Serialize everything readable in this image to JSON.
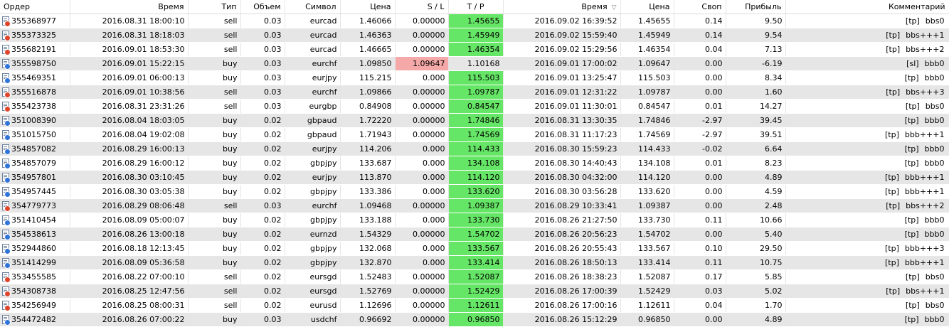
{
  "headers": {
    "order": "Ордер",
    "open_time": "Время",
    "type": "Тип",
    "volume": "Объем",
    "symbol": "Символ",
    "open_price": "Цена",
    "sl": "S / L",
    "tp": "T / P",
    "close_time": "Время",
    "close_price": "Цена",
    "swap": "Своп",
    "profit": "Прибыль",
    "comment": "Комментарий"
  },
  "sort_indicator": "▽",
  "colors": {
    "tp_highlight": "#66e666",
    "sl_highlight": "#f5a8a8",
    "alt_row": "#e6e6e6"
  },
  "rows": [
    {
      "order": "355368977",
      "open_time": "2016.08.31 18:00:10",
      "type": "sell",
      "volume": "0.03",
      "symbol": "eurcad",
      "open_price": "1.46066",
      "sl": "0.00000",
      "tp": "1.45655",
      "close_time": "2016.09.02 16:39:52",
      "close_price": "1.45655",
      "swap": "0.14",
      "profit": "9.50",
      "comment_tag": "[tp]",
      "comment_text": "bbs0",
      "hl": "tp"
    },
    {
      "order": "355373325",
      "open_time": "2016.08.31 18:18:03",
      "type": "sell",
      "volume": "0.03",
      "symbol": "eurcad",
      "open_price": "1.46363",
      "sl": "0.00000",
      "tp": "1.45949",
      "close_time": "2016.09.02 15:59:40",
      "close_price": "1.45949",
      "swap": "0.14",
      "profit": "9.54",
      "comment_tag": "[tp]",
      "comment_text": "bbs+++1",
      "hl": "tp"
    },
    {
      "order": "355682191",
      "open_time": "2016.09.01 18:53:30",
      "type": "sell",
      "volume": "0.03",
      "symbol": "eurcad",
      "open_price": "1.46665",
      "sl": "0.00000",
      "tp": "1.46354",
      "close_time": "2016.09.02 15:29:56",
      "close_price": "1.46354",
      "swap": "0.04",
      "profit": "7.13",
      "comment_tag": "[tp]",
      "comment_text": "bbs+++2",
      "hl": "tp"
    },
    {
      "order": "355598750",
      "open_time": "2016.09.01 15:22:15",
      "type": "buy",
      "volume": "0.03",
      "symbol": "eurchf",
      "open_price": "1.09850",
      "sl": "1.09647",
      "tp": "1.10168",
      "close_time": "2016.09.01 17:00:02",
      "close_price": "1.09647",
      "swap": "0.00",
      "profit": "-6.19",
      "comment_tag": "[sl]",
      "comment_text": "bbb0",
      "hl": "sl"
    },
    {
      "order": "355469351",
      "open_time": "2016.09.01 06:00:13",
      "type": "buy",
      "volume": "0.03",
      "symbol": "eurjpy",
      "open_price": "115.215",
      "sl": "0.000",
      "tp": "115.503",
      "close_time": "2016.09.01 13:25:47",
      "close_price": "115.503",
      "swap": "0.00",
      "profit": "8.34",
      "comment_tag": "[tp]",
      "comment_text": "bbb0",
      "hl": "tp"
    },
    {
      "order": "355516878",
      "open_time": "2016.09.01 10:38:56",
      "type": "sell",
      "volume": "0.03",
      "symbol": "eurchf",
      "open_price": "1.09866",
      "sl": "0.00000",
      "tp": "1.09787",
      "close_time": "2016.09.01 12:31:22",
      "close_price": "1.09787",
      "swap": "0.00",
      "profit": "1.60",
      "comment_tag": "[tp]",
      "comment_text": "bbs+++3",
      "hl": "tp"
    },
    {
      "order": "355423738",
      "open_time": "2016.08.31 23:31:26",
      "type": "sell",
      "volume": "0.03",
      "symbol": "eurgbp",
      "open_price": "0.84908",
      "sl": "0.00000",
      "tp": "0.84547",
      "close_time": "2016.09.01 11:30:01",
      "close_price": "0.84547",
      "swap": "0.01",
      "profit": "14.27",
      "comment_tag": "[tp]",
      "comment_text": "bbs0",
      "hl": "tp"
    },
    {
      "order": "351008390",
      "open_time": "2016.08.04 18:03:05",
      "type": "buy",
      "volume": "0.02",
      "symbol": "gbpaud",
      "open_price": "1.72220",
      "sl": "0.00000",
      "tp": "1.74846",
      "close_time": "2016.08.31 13:30:35",
      "close_price": "1.74846",
      "swap": "-2.97",
      "profit": "39.45",
      "comment_tag": "[tp]",
      "comment_text": "bbb0",
      "hl": "tp"
    },
    {
      "order": "351015750",
      "open_time": "2016.08.04 19:02:08",
      "type": "buy",
      "volume": "0.02",
      "symbol": "gbpaud",
      "open_price": "1.71943",
      "sl": "0.00000",
      "tp": "1.74569",
      "close_time": "2016.08.31 11:17:23",
      "close_price": "1.74569",
      "swap": "-2.97",
      "profit": "39.51",
      "comment_tag": "[tp]",
      "comment_text": "bbb+++1",
      "hl": "tp"
    },
    {
      "order": "354857082",
      "open_time": "2016.08.29 16:00:13",
      "type": "buy",
      "volume": "0.02",
      "symbol": "eurjpy",
      "open_price": "114.206",
      "sl": "0.000",
      "tp": "114.433",
      "close_time": "2016.08.30 15:59:23",
      "close_price": "114.433",
      "swap": "-0.02",
      "profit": "6.64",
      "comment_tag": "[tp]",
      "comment_text": "bbb0",
      "hl": "tp"
    },
    {
      "order": "354857079",
      "open_time": "2016.08.29 16:00:12",
      "type": "buy",
      "volume": "0.02",
      "symbol": "gbpjpy",
      "open_price": "133.687",
      "sl": "0.000",
      "tp": "134.108",
      "close_time": "2016.08.30 14:40:43",
      "close_price": "134.108",
      "swap": "0.01",
      "profit": "8.23",
      "comment_tag": "[tp]",
      "comment_text": "bbb0",
      "hl": "tp"
    },
    {
      "order": "354957801",
      "open_time": "2016.08.30 03:10:45",
      "type": "buy",
      "volume": "0.02",
      "symbol": "eurjpy",
      "open_price": "113.870",
      "sl": "0.000",
      "tp": "114.120",
      "close_time": "2016.08.30 04:32:00",
      "close_price": "114.120",
      "swap": "0.00",
      "profit": "4.89",
      "comment_tag": "[tp]",
      "comment_text": "bbb+++1",
      "hl": "tp"
    },
    {
      "order": "354957445",
      "open_time": "2016.08.30 03:05:38",
      "type": "buy",
      "volume": "0.02",
      "symbol": "gbpjpy",
      "open_price": "133.386",
      "sl": "0.000",
      "tp": "133.620",
      "close_time": "2016.08.30 03:56:28",
      "close_price": "133.620",
      "swap": "0.00",
      "profit": "4.59",
      "comment_tag": "[tp]",
      "comment_text": "bbb+++1",
      "hl": "tp"
    },
    {
      "order": "354779773",
      "open_time": "2016.08.29 08:06:48",
      "type": "sell",
      "volume": "0.03",
      "symbol": "eurchf",
      "open_price": "1.09468",
      "sl": "0.00000",
      "tp": "1.09387",
      "close_time": "2016.08.29 10:33:41",
      "close_price": "1.09387",
      "swap": "0.00",
      "profit": "2.48",
      "comment_tag": "[tp]",
      "comment_text": "bbs+++2",
      "hl": "tp"
    },
    {
      "order": "351410454",
      "open_time": "2016.08.09 05:00:07",
      "type": "buy",
      "volume": "0.02",
      "symbol": "gbpjpy",
      "open_price": "133.188",
      "sl": "0.000",
      "tp": "133.730",
      "close_time": "2016.08.26 21:27:50",
      "close_price": "133.730",
      "swap": "0.11",
      "profit": "10.66",
      "comment_tag": "[tp]",
      "comment_text": "bbb0",
      "hl": "tp"
    },
    {
      "order": "354538613",
      "open_time": "2016.08.26 13:00:18",
      "type": "buy",
      "volume": "0.02",
      "symbol": "eurnzd",
      "open_price": "1.54329",
      "sl": "0.00000",
      "tp": "1.54702",
      "close_time": "2016.08.26 20:56:23",
      "close_price": "1.54702",
      "swap": "0.00",
      "profit": "5.40",
      "comment_tag": "[tp]",
      "comment_text": "bbb0",
      "hl": "tp"
    },
    {
      "order": "352944860",
      "open_time": "2016.08.18 12:13:45",
      "type": "buy",
      "volume": "0.02",
      "symbol": "gbpjpy",
      "open_price": "132.068",
      "sl": "0.000",
      "tp": "133.567",
      "close_time": "2016.08.26 20:55:43",
      "close_price": "133.567",
      "swap": "0.10",
      "profit": "29.50",
      "comment_tag": "[tp]",
      "comment_text": "bbb+++3",
      "hl": "tp"
    },
    {
      "order": "351414299",
      "open_time": "2016.08.09 05:36:58",
      "type": "buy",
      "volume": "0.02",
      "symbol": "gbpjpy",
      "open_price": "132.870",
      "sl": "0.000",
      "tp": "133.414",
      "close_time": "2016.08.26 18:50:13",
      "close_price": "133.414",
      "swap": "0.11",
      "profit": "10.75",
      "comment_tag": "[tp]",
      "comment_text": "bbb+++1",
      "hl": "tp"
    },
    {
      "order": "353455585",
      "open_time": "2016.08.22 07:00:10",
      "type": "sell",
      "volume": "0.02",
      "symbol": "eursgd",
      "open_price": "1.52483",
      "sl": "0.00000",
      "tp": "1.52087",
      "close_time": "2016.08.26 18:38:23",
      "close_price": "1.52087",
      "swap": "0.17",
      "profit": "5.85",
      "comment_tag": "[tp]",
      "comment_text": "bbs0",
      "hl": "tp"
    },
    {
      "order": "354308738",
      "open_time": "2016.08.25 12:47:56",
      "type": "sell",
      "volume": "0.02",
      "symbol": "eursgd",
      "open_price": "1.52769",
      "sl": "0.00000",
      "tp": "1.52429",
      "close_time": "2016.08.26 17:00:39",
      "close_price": "1.52429",
      "swap": "0.03",
      "profit": "5.02",
      "comment_tag": "[tp]",
      "comment_text": "bbs+++1",
      "hl": "tp"
    },
    {
      "order": "354256949",
      "open_time": "2016.08.25 08:00:31",
      "type": "sell",
      "volume": "0.02",
      "symbol": "eurusd",
      "open_price": "1.12696",
      "sl": "0.00000",
      "tp": "1.12611",
      "close_time": "2016.08.26 17:00:16",
      "close_price": "1.12611",
      "swap": "0.04",
      "profit": "1.70",
      "comment_tag": "[tp]",
      "comment_text": "bbs0",
      "hl": "tp"
    },
    {
      "order": "354472482",
      "open_time": "2016.08.26 07:00:22",
      "type": "buy",
      "volume": "0.03",
      "symbol": "usdchf",
      "open_price": "0.96692",
      "sl": "0.00000",
      "tp": "0.96850",
      "close_time": "2016.08.26 15:12:29",
      "close_price": "0.96850",
      "swap": "0.00",
      "profit": "4.89",
      "comment_tag": "[tp]",
      "comment_text": "bbb0",
      "hl": "tp"
    }
  ]
}
